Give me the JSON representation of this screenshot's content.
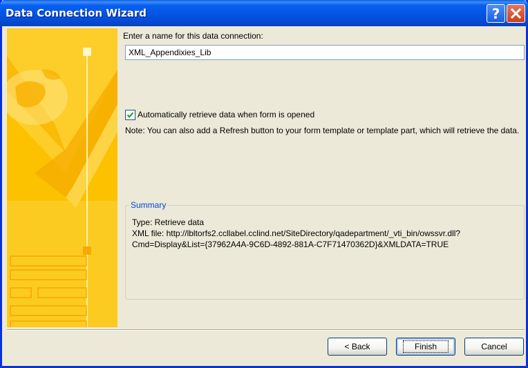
{
  "window": {
    "title": "Data Connection Wizard"
  },
  "form": {
    "name_label": "Enter a name for this data connection:",
    "name_value": "XML_Appendixies_Lib",
    "auto_retrieve_label": "Automatically retrieve data when form is opened",
    "auto_retrieve_checked": true,
    "note": "Note: You can also add a Refresh button to your form template or template part, which will retrieve the data."
  },
  "summary": {
    "legend": "Summary",
    "type_line": "Type: Retrieve data",
    "xml_line": "XML file: http://lbltorfs2.ccllabel.cclind.net/SiteDirectory/qadepartment/_vti_bin/owssvr.dll?",
    "cmd_line": "Cmd=Display&List={37962A4A-9C6D-4892-881A-C7F71470362D}&XMLDATA=TRUE"
  },
  "buttons": {
    "back": "< Back",
    "finish": "Finish",
    "cancel": "Cancel"
  },
  "colors": {
    "title_bar": "#0353e0",
    "art_background": "#fcc200",
    "summary_legend": "#0046d5"
  },
  "icons": {
    "help": "help-icon",
    "close": "close-icon",
    "check": "checkmark-icon"
  }
}
